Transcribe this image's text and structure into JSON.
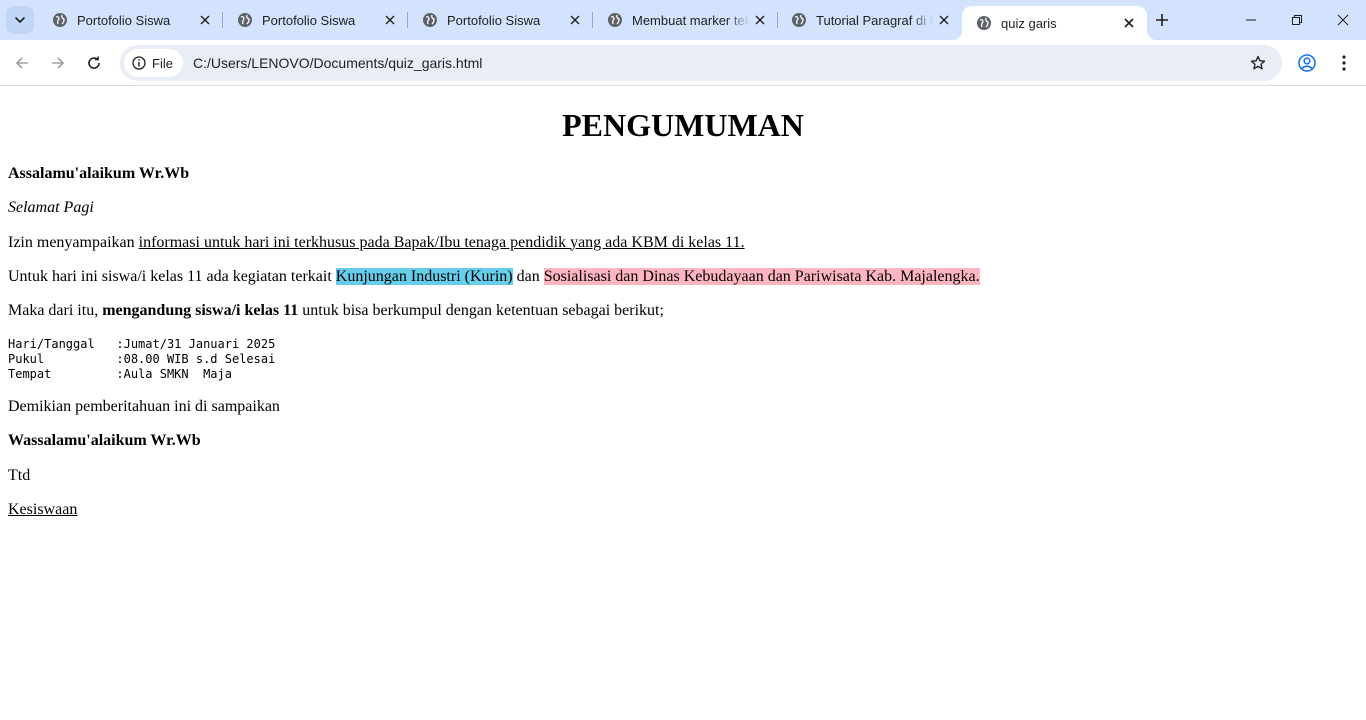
{
  "browser": {
    "tabs": [
      {
        "title": "Portofolio Siswa",
        "active": false
      },
      {
        "title": "Portofolio Siswa",
        "active": false
      },
      {
        "title": "Portofolio Siswa",
        "active": false
      },
      {
        "title": "Membuat marker teks",
        "active": false
      },
      {
        "title": "Tutorial Paragraf di HTML",
        "active": false
      },
      {
        "title": "quiz garis",
        "active": true
      }
    ],
    "chip_label": "File",
    "url": "C:/Users/LENOVO/Documents/quiz_garis.html",
    "icons": {
      "tab_search": "chevron-down-icon",
      "tab_favicon": "globe-icon",
      "tab_close": "close-icon",
      "new_tab": "plus-icon",
      "minimize": "minimize-icon",
      "restore": "restore-icon",
      "close_window": "close-icon",
      "back": "arrow-left-icon",
      "forward": "arrow-right-icon",
      "reload": "reload-icon",
      "site_info": "info-icon",
      "bookmark": "star-icon",
      "profile": "profile-icon",
      "menu": "kebab-menu-icon"
    },
    "colors": {
      "tabstrip_bg": "#d3e3fd",
      "omnibox_bg": "#e9eef6",
      "highlight_blue": "#66cdea",
      "highlight_pink": "#ffb6c1"
    }
  },
  "content": {
    "heading": "PENGUMUMAN",
    "greeting": "Assalamu'alaikum Wr.Wb",
    "salam": "Selamat Pagi",
    "para1_prefix": "Izin menyampaikan ",
    "para1_underlined": "informasi untuk hari ini terkhusus pada Bapak/Ibu tenaga pendidik yang ada KBM di kelas 11.",
    "para2_prefix": "Untuk hari ini siswa/i kelas 11 ada kegiatan terkait ",
    "para2_highlight1": "Kunjungan Industri (Kurin)",
    "para2_mid": " dan ",
    "para2_highlight2": "Sosialisasi dan Dinas Kebudayaan dan Pariwisata Kab. Majalengka.",
    "para3_prefix": "Maka dari itu, ",
    "para3_bold": "mengandung siswa/i kelas 11",
    "para3_suffix": " untuk bisa berkumpul dengan ketentuan sebagai berikut;",
    "schedule": [
      {
        "label": "Hari/Tanggal",
        "value": "Jumat/31 Januari 2025"
      },
      {
        "label": "Pukul",
        "value": "08.00 WIB s.d Selesai"
      },
      {
        "label": "Tempat",
        "value": "Aula SMKN  Maja"
      }
    ],
    "closing": "Demikian pemberitahuan ini di sampaikan",
    "farewell": "Wassalamu'alaikum Wr.Wb",
    "ttd": "Ttd",
    "signature": "Kesiswaan"
  }
}
